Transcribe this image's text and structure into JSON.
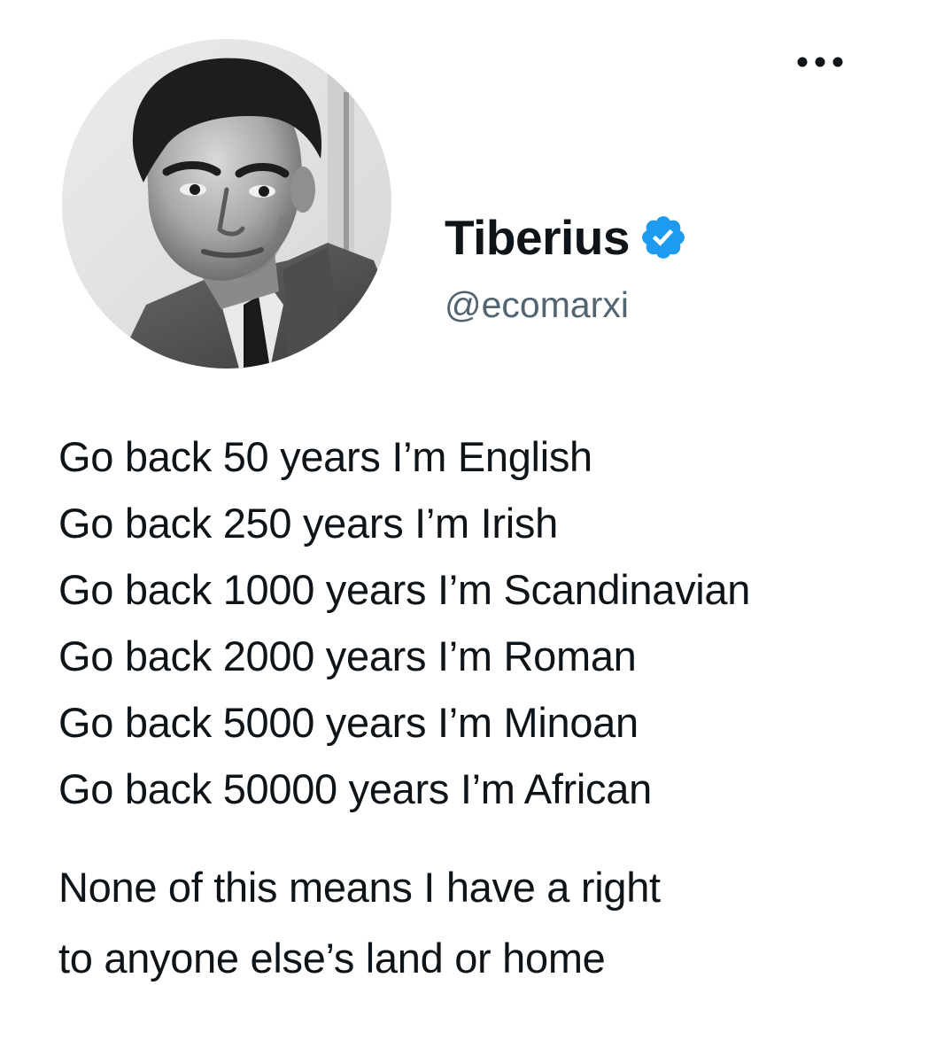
{
  "tweet": {
    "author": {
      "display_name": "Tiberius",
      "handle": "@ecomarxi",
      "verified": true,
      "verified_icon": "verified-badge-icon",
      "avatar": "profile-photo"
    },
    "more_icon": "more-horizontal-icon",
    "body_lines": [
      "Go back 50 years I’m English",
      "Go back 250 years I’m Irish",
      "Go back 1000 years I’m Scandinavian",
      "Go back 2000 years I’m Roman",
      "Go back 5000 years I’m Minoan",
      "Go back 50000 years I’m African"
    ],
    "closing_lines": [
      "None of this means I have a right",
      "to anyone else’s land or home"
    ]
  },
  "colors": {
    "text": "#0f1419",
    "secondary_text": "#536471",
    "verified_blue": "#1d9bf0",
    "background": "#ffffff"
  }
}
